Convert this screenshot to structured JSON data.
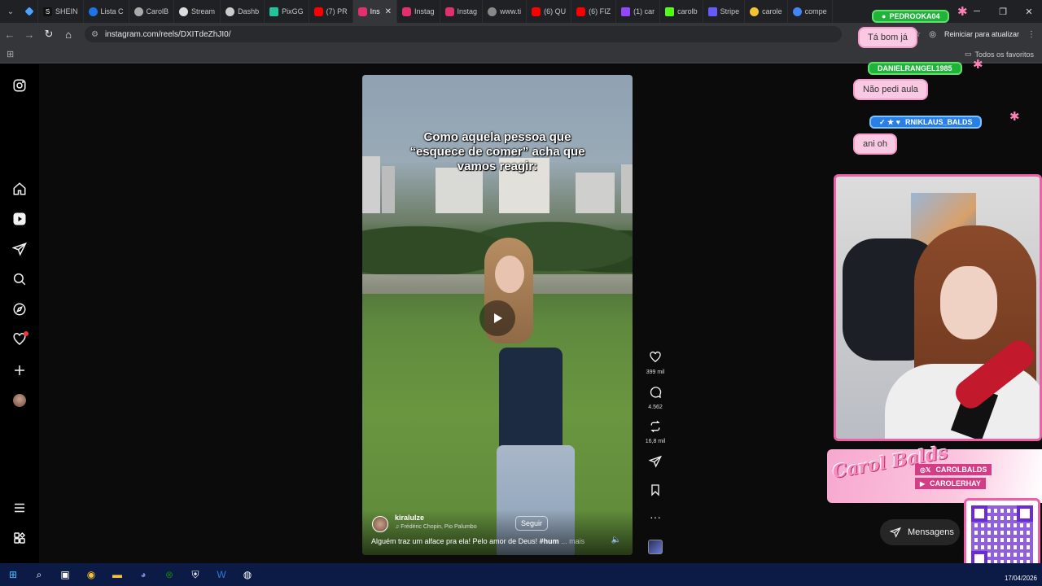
{
  "browser": {
    "tabs": [
      {
        "label": "",
        "icon": "tab-menu"
      },
      {
        "label": "",
        "icon": "gem",
        "color": "#4aa3ff"
      },
      {
        "label": "SHEIN",
        "color": "#111111"
      },
      {
        "label": "Lista C",
        "color": "#1f73e8"
      },
      {
        "label": "CarolB",
        "color": "#aaaaaa"
      },
      {
        "label": "Stream",
        "color": "#dddddd"
      },
      {
        "label": "Dashb",
        "color": "#cccccc"
      },
      {
        "label": "PixGG",
        "color": "#22c39a"
      },
      {
        "label": "(7) PR",
        "color": "#ff0000"
      },
      {
        "label": "Ins",
        "color": "#e1306c",
        "active": true
      },
      {
        "label": "Instag",
        "color": "#e1306c"
      },
      {
        "label": "Instag",
        "color": "#e1306c"
      },
      {
        "label": "www.ti",
        "color": "#888888"
      },
      {
        "label": "(6) QU",
        "color": "#ff0000"
      },
      {
        "label": "(6) FIZ",
        "color": "#ff0000"
      },
      {
        "label": "(1) car",
        "color": "#9146ff"
      },
      {
        "label": "carolb",
        "color": "#53fc18"
      },
      {
        "label": "Stripe",
        "color": "#635bff"
      },
      {
        "label": "carole",
        "color": "#f4c430"
      },
      {
        "label": "compe",
        "color": "#4285f4"
      }
    ],
    "url": "instagram.com/reels/DXITdeZhJI0/",
    "restart_label": "Reiniciar para atualizar",
    "all_favorites": "Todos os favoritos"
  },
  "instagram": {
    "reel": {
      "overlay_text": "Como aquela pessoa que “esquece de comer” acha que vamos reagir:",
      "username": "kiralulze",
      "audio": "Frédéric Chopin, Pio Palumbo",
      "follow_label": "Seguir",
      "description": "Alguém traz um alface pra ela! Pelo amor de Deus!",
      "hashtag": "#hum",
      "more_label": "... mais"
    },
    "actions": {
      "likes": "399 mil",
      "comments": "4.562",
      "reposts": "16,8 mil"
    },
    "messages_label": "Mensagens"
  },
  "stream_overlay": {
    "chat": [
      {
        "name": "PEDROOKA04",
        "text": "Tá bom já"
      },
      {
        "name": "DANIELRANGEL1985",
        "text": "Não pedi aula"
      },
      {
        "name": "RNIKLAUS_BALDS",
        "text": "ani oh"
      }
    ],
    "brand_name": "Carol Balds",
    "socials": [
      {
        "icon": "instagram-x",
        "handle": "CAROLBALDS"
      },
      {
        "icon": "youtube",
        "handle": "CAROLERHAY"
      }
    ]
  },
  "taskbar": {
    "date": "17/04/2026"
  }
}
